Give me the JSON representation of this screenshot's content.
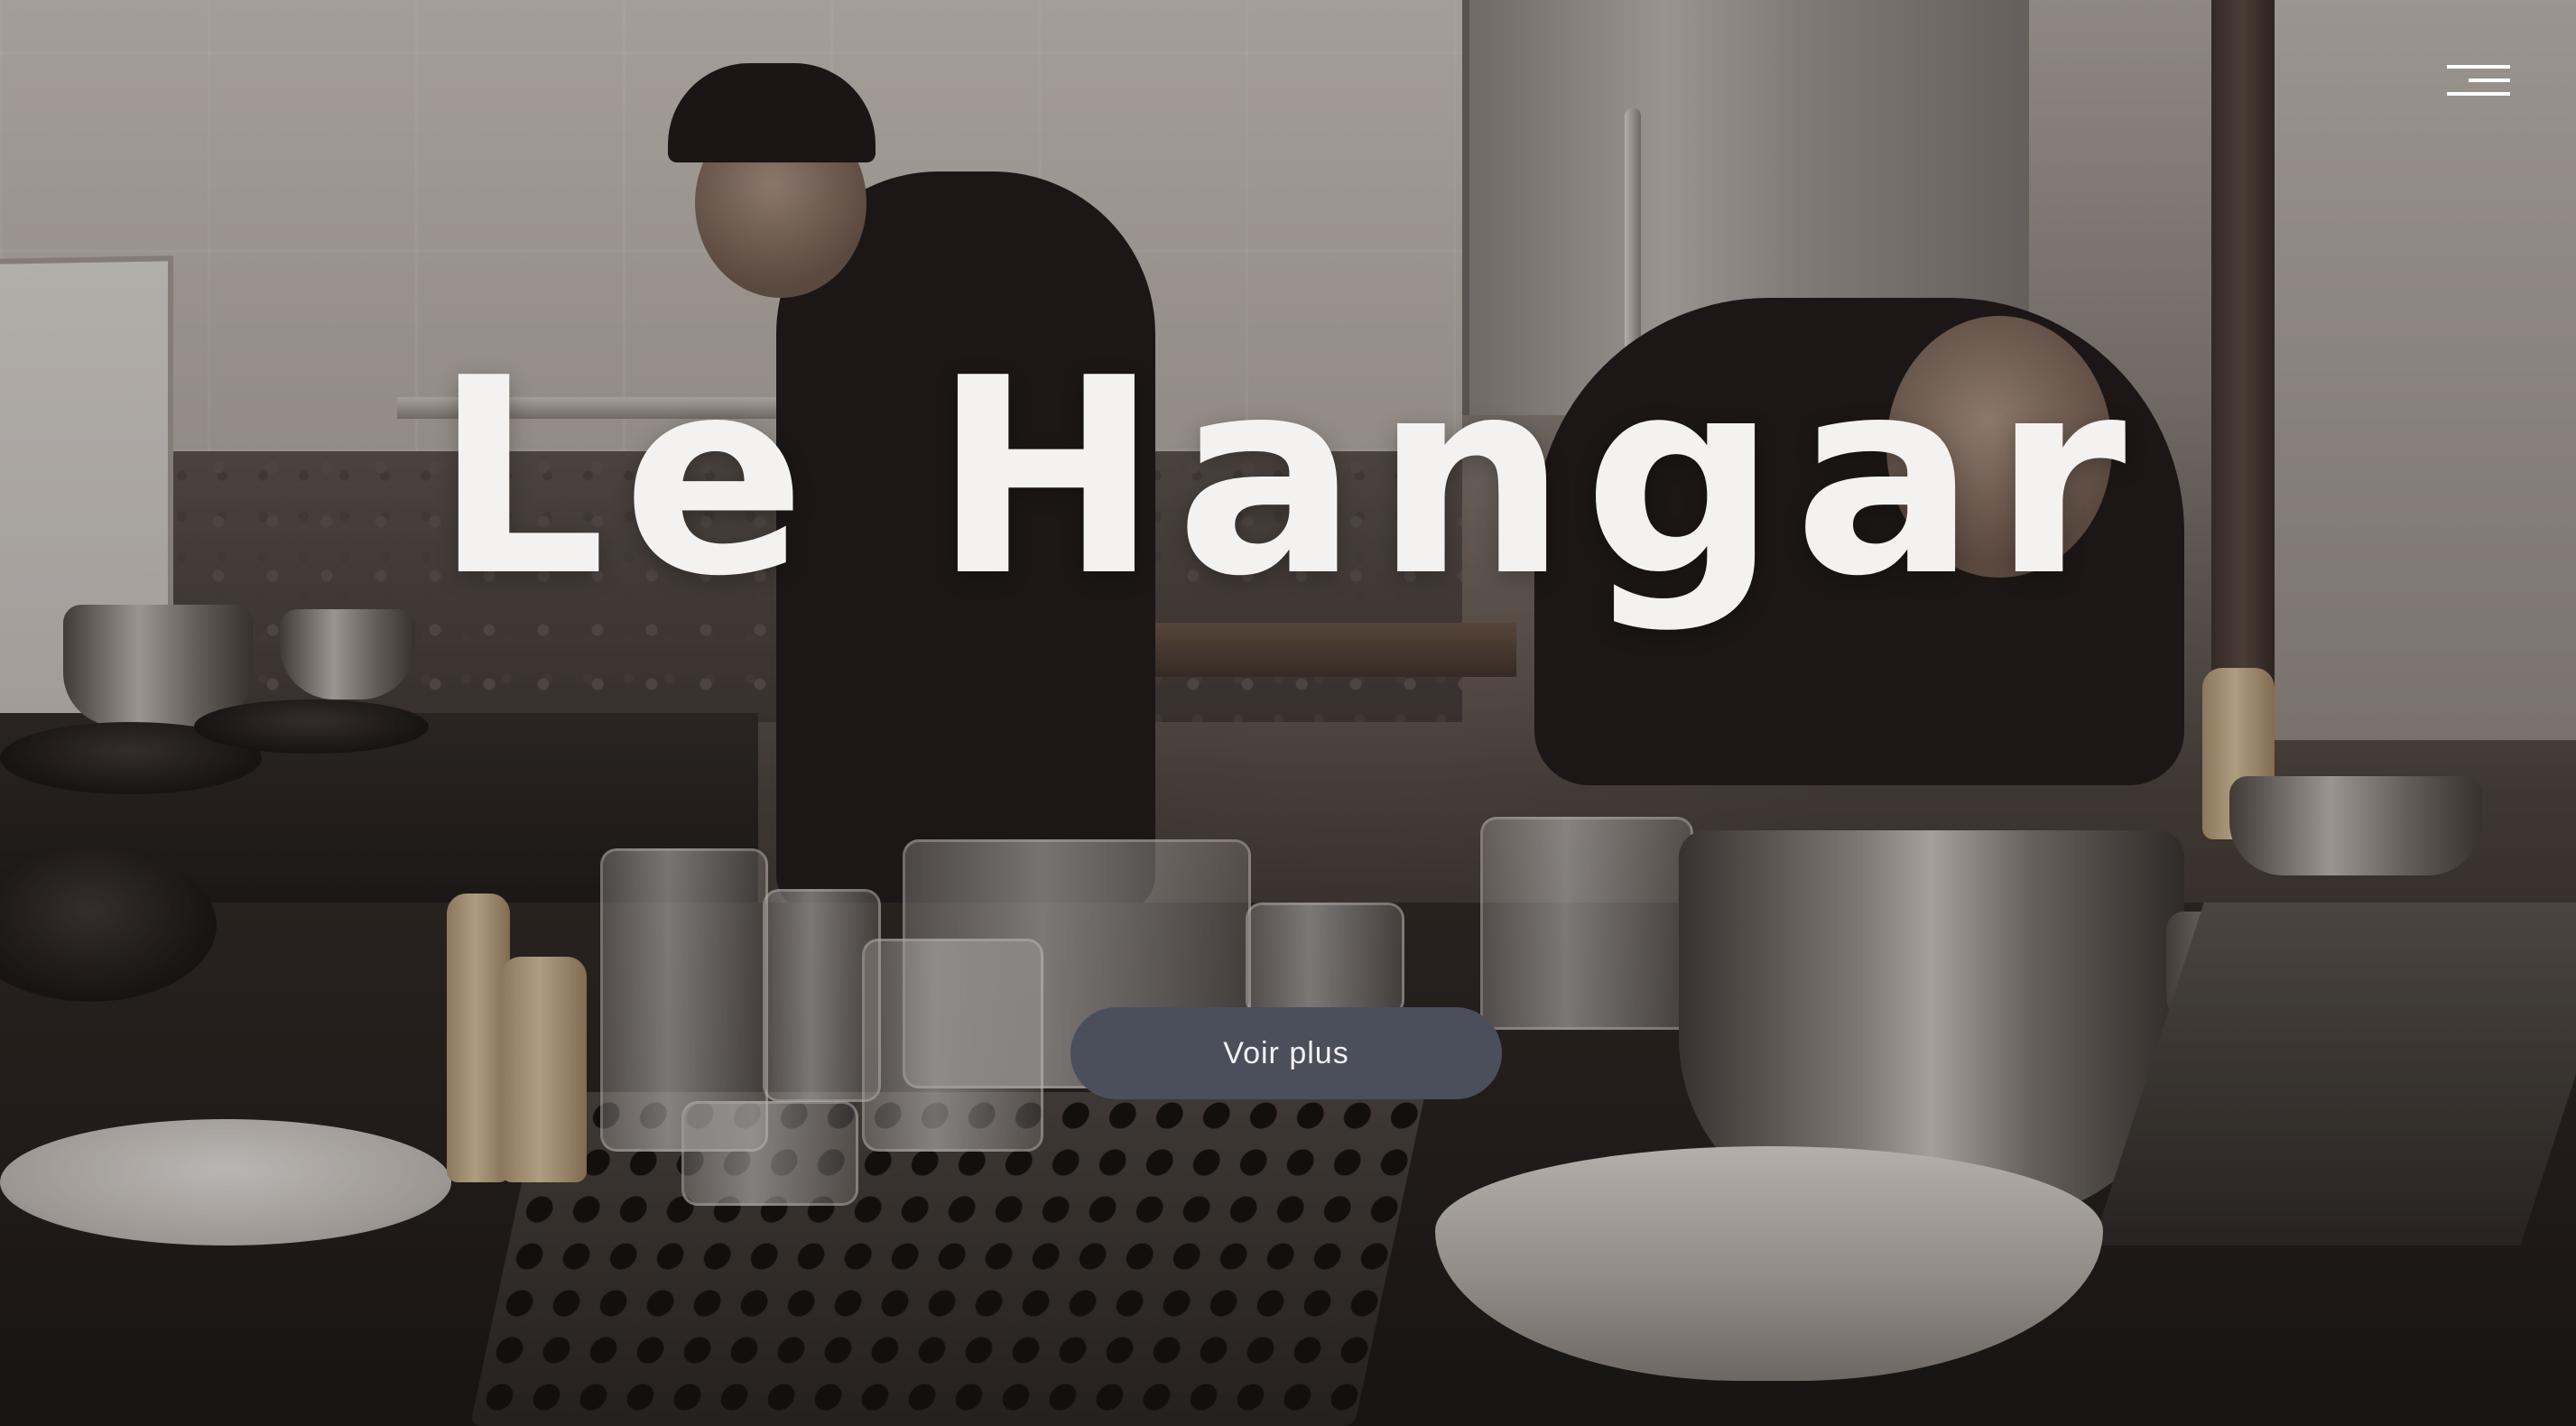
{
  "hero": {
    "title": "Le Hangar",
    "cta_label": "Voir plus",
    "background_image": "kitchen-chefs-photo"
  },
  "header": {
    "menu_icon": "hamburger-menu-icon"
  },
  "colors": {
    "title_text": "#f4f2f0",
    "cta_background": "#4b4e5b",
    "cta_text": "#f1f1f3",
    "menu_icon": "#ffffff"
  }
}
